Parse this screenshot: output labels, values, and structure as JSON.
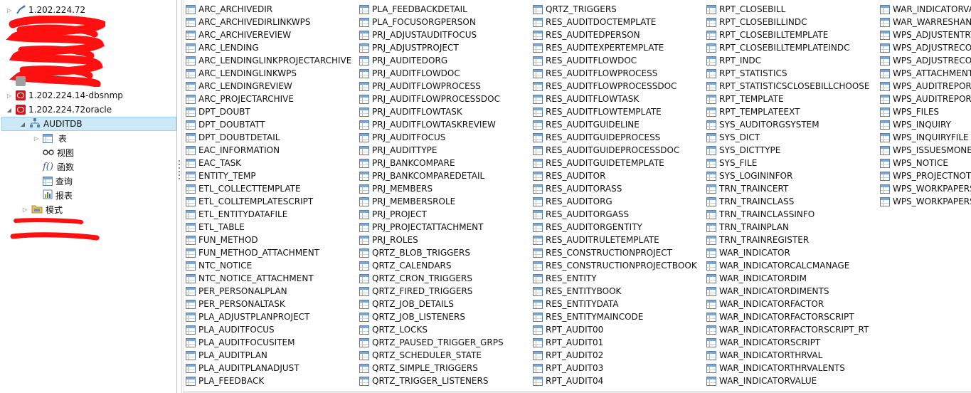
{
  "sidebar": {
    "connections": {
      "conn1": "1.202.224.72",
      "conn_dbsnmp": "1.202.224.14-dbsnmp",
      "conn_oracle": "1.202.224.72oracle"
    },
    "schema": "AUDITDB",
    "children": [
      "表",
      "视图",
      "函数",
      "查询",
      "报表"
    ],
    "mode_node": "模式"
  },
  "tables": [
    [
      "ARC_ARCHIVEDIR",
      "ARC_ARCHIVEDIRLINKWPS",
      "ARC_ARCHIVEREVIEW",
      "ARC_LENDING",
      "ARC_LENDINGLINKPROJECTARCHIVE",
      "ARC_LENDINGLINKWPS",
      "ARC_LENDINGREVIEW",
      "ARC_PROJECTARCHIVE",
      "DPT_DOUBT",
      "DPT_DOUBTATT",
      "DPT_DOUBTDETAIL",
      "EAC_INFORMATION",
      "EAC_TASK",
      "ENTITY_TEMP",
      "ETL_COLLECTTEMPLATE",
      "ETL_COLLTEMPLATESCRIPT",
      "ETL_ENTITYDATAFILE",
      "ETL_TABLE",
      "FUN_METHOD",
      "FUN_METHOD_ATTACHMENT",
      "NTC_NOTICE",
      "NTC_NOTICE_ATTACHMENT",
      "PER_PERSONALPLAN",
      "PER_PERSONALTASK",
      "PLA_ADJUSTPLANPROJECT",
      "PLA_AUDITFOCUS",
      "PLA_AUDITFOCUSITEM",
      "PLA_AUDITPLAN",
      "PLA_AUDITPLANADJUST",
      "PLA_FEEDBACK"
    ],
    [
      "PLA_FEEDBACKDETAIL",
      "PLA_FOCUSORGPERSON",
      "PRJ_ADJUSTAUDITFOCUS",
      "PRJ_ADJUSTPROJECT",
      "PRJ_AUDITEDORG",
      "PRJ_AUDITFLOWDOC",
      "PRJ_AUDITFLOWPROCESS",
      "PRJ_AUDITFLOWPROCESSDOC",
      "PRJ_AUDITFLOWTASK",
      "PRJ_AUDITFLOWTASKREVIEW",
      "PRJ_AUDITFOCUS",
      "PRJ_AUDITTYPE",
      "PRJ_BANKCOMPARE",
      "PRJ_BANKCOMPAREDETAIL",
      "PRJ_MEMBERS",
      "PRJ_MEMBERSROLE",
      "PRJ_PROJECT",
      "PRJ_PROJECTATTACHMENT",
      "PRJ_ROLES",
      "QRTZ_BLOB_TRIGGERS",
      "QRTZ_CALENDARS",
      "QRTZ_CRON_TRIGGERS",
      "QRTZ_FIRED_TRIGGERS",
      "QRTZ_JOB_DETAILS",
      "QRTZ_JOB_LISTENERS",
      "QRTZ_LOCKS",
      "QRTZ_PAUSED_TRIGGER_GRPS",
      "QRTZ_SCHEDULER_STATE",
      "QRTZ_SIMPLE_TRIGGERS",
      "QRTZ_TRIGGER_LISTENERS"
    ],
    [
      "QRTZ_TRIGGERS",
      "RES_AUDITDOCTEMPLATE",
      "RES_AUDITEDPERSON",
      "RES_AUDITEXPERTEMPLATE",
      "RES_AUDITFLOWDOC",
      "RES_AUDITFLOWPROCESS",
      "RES_AUDITFLOWPROCESSDOC",
      "RES_AUDITFLOWTASK",
      "RES_AUDITFLOWTEMPLATE",
      "RES_AUDITGUIDELINE",
      "RES_AUDITGUIDEPROCESS",
      "RES_AUDITGUIDEPROCESSDOC",
      "RES_AUDITGUIDETEMPLATE",
      "RES_AUDITOR",
      "RES_AUDITORASS",
      "RES_AUDITORG",
      "RES_AUDITORGASS",
      "RES_AUDITORGENTITY",
      "RES_AUDITRULETEMPLATE",
      "RES_CONSTRUCTIONPROJECT",
      "RES_CONSTRUCTIONPROJECTBOOK",
      "RES_ENTITY",
      "RES_ENTITYBOOK",
      "RES_ENTITYDATA",
      "RES_ENTITYMAINCODE",
      "RPT_AUDIT00",
      "RPT_AUDIT01",
      "RPT_AUDIT02",
      "RPT_AUDIT03",
      "RPT_AUDIT04"
    ],
    [
      "RPT_CLOSEBILL",
      "RPT_CLOSEBILLINDC",
      "RPT_CLOSEBILLTEMPLATE",
      "RPT_CLOSEBILLTEMPLATEINDC",
      "RPT_INDC",
      "RPT_STATISTICS",
      "RPT_STATISTICSCLOSEBILLCHOOSE",
      "RPT_TEMPLATE",
      "RPT_TEMPLATEEXT",
      "SYS_AUDITORGSYSTEM",
      "SYS_DICT",
      "SYS_DICTTYPE",
      "SYS_FILE",
      "SYS_LOGININFOR",
      "TRN_TRAINCERT",
      "TRN_TRAINCLASS",
      "TRN_TRAINCLASSINFO",
      "TRN_TRAINPLAN",
      "TRN_TRAINREGISTER",
      "WAR_INDICATOR",
      "WAR_INDICATORCALCMANAGE",
      "WAR_INDICATORDIM",
      "WAR_INDICATORDIMENTS",
      "WAR_INDICATORFACTOR",
      "WAR_INDICATORFACTORSCRIPT",
      "WAR_INDICATORFACTORSCRIPT_RT",
      "WAR_INDICATORSCRIPT",
      "WAR_INDICATORTHRVAL",
      "WAR_INDICATORTHRVALENTS",
      "WAR_INDICATORVALUE"
    ],
    [
      "WAR_INDICATORVA",
      "WAR_WARRESHAN",
      "WPS_ADJUSTENTRY",
      "WPS_ADJUSTRECOI",
      "WPS_ADJUSTRECOI",
      "WPS_ATTACHMENT",
      "WPS_AUDITREPORT",
      "WPS_AUDITREPORT",
      "WPS_FILES",
      "WPS_INQUIRY",
      "WPS_INQUIRYFILE",
      "WPS_ISSUESMONE",
      "WPS_NOTICE",
      "WPS_PROJECTNOT",
      "WPS_WORKPAPERS",
      "WPS_WORKPAPERS"
    ]
  ]
}
